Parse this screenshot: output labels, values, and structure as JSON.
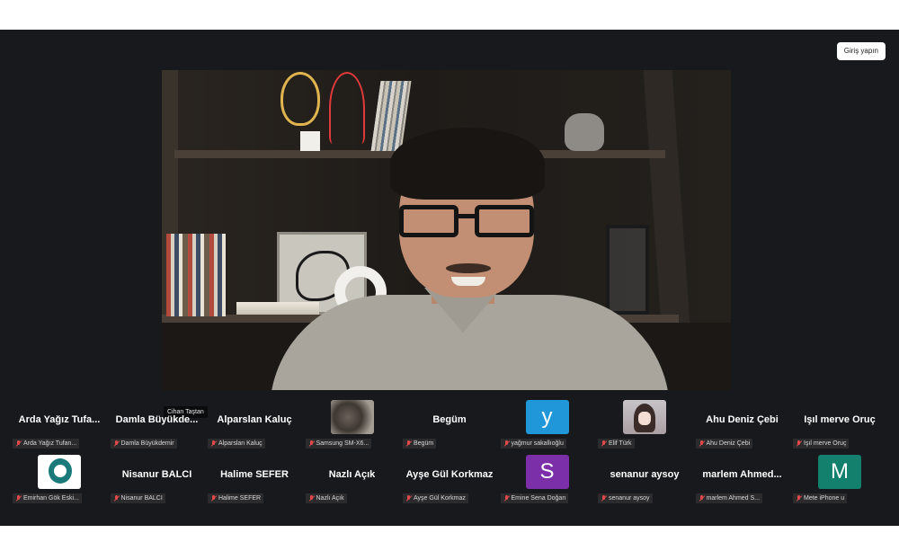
{
  "header": {
    "signin_label": "Giriş yapın"
  },
  "main_video": {
    "speaker_name": "Cihan Taştan"
  },
  "participants_row1": [
    {
      "name": "Arda Yağız Tufa...",
      "label": "Arda Yağız Tufan...",
      "tile": "name"
    },
    {
      "name": "Damla Büyükde...",
      "label": "Damla Büyükdemir",
      "tile": "name"
    },
    {
      "name": "Alparslan Kaluç",
      "label": "Alparslan Kaluç",
      "tile": "name"
    },
    {
      "name": "",
      "label": "Samsung SM-X6...",
      "tile": "video-blur"
    },
    {
      "name": "Begüm",
      "label": "Begüm",
      "tile": "name"
    },
    {
      "name": "",
      "label": "yağmur sakallıoğlu",
      "tile": "avatar",
      "letter": "y",
      "color": "#1f97d9"
    },
    {
      "name": "",
      "label": "Elif Türk",
      "tile": "video-anime"
    },
    {
      "name": "Ahu Deniz Çebi",
      "label": "Ahu Deniz Çebi",
      "tile": "name"
    },
    {
      "name": "Işıl merve Oruç",
      "label": "Işıl merve Oruç",
      "tile": "name"
    }
  ],
  "participants_row2": [
    {
      "name": "",
      "label": "Emirhan Gök Eski...",
      "tile": "logo"
    },
    {
      "name": "Nisanur BALCI",
      "label": "Nisanur BALCI",
      "tile": "name"
    },
    {
      "name": "Halime  SEFER",
      "label": "Halime  SEFER",
      "tile": "name"
    },
    {
      "name": "Nazlı Açık",
      "label": "Nazlı Açık",
      "tile": "name"
    },
    {
      "name": "Ayşe Gül Korkmaz",
      "label": "Ayşe Gül Korkmaz",
      "tile": "name"
    },
    {
      "name": "",
      "label": "Emine Sena Doğan",
      "tile": "avatar",
      "letter": "S",
      "color": "#7b2fa8"
    },
    {
      "name": "senanur aysoy",
      "label": "senanur aysoy",
      "tile": "name"
    },
    {
      "name": "marlem  Ahmed...",
      "label": "marlem Ahmed S...",
      "tile": "name"
    },
    {
      "name": "",
      "label": "Mete iPhone u",
      "tile": "avatar",
      "letter": "M",
      "color": "#13806e"
    }
  ]
}
